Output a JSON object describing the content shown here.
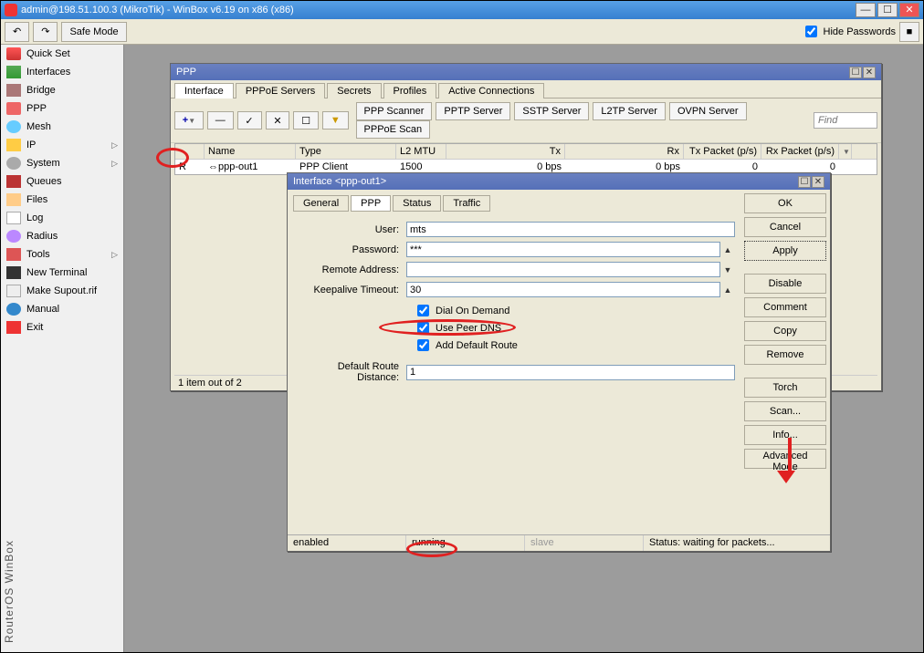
{
  "title": "admin@198.51.100.3 (MikroTik) - WinBox v6.19 on x86 (x86)",
  "toolbar": {
    "safemode": "Safe Mode",
    "hidepw": "Hide Passwords"
  },
  "sidebar": [
    {
      "label": "Quick Set",
      "cls": "qs"
    },
    {
      "label": "Interfaces",
      "cls": "if"
    },
    {
      "label": "Bridge",
      "cls": "br"
    },
    {
      "label": "PPP",
      "cls": "ppp"
    },
    {
      "label": "Mesh",
      "cls": "mesh"
    },
    {
      "label": "IP",
      "cls": "ip",
      "sub": true
    },
    {
      "label": "System",
      "cls": "sys",
      "sub": true
    },
    {
      "label": "Queues",
      "cls": "qu"
    },
    {
      "label": "Files",
      "cls": "fi"
    },
    {
      "label": "Log",
      "cls": "lg"
    },
    {
      "label": "Radius",
      "cls": "rd"
    },
    {
      "label": "Tools",
      "cls": "to",
      "sub": true
    },
    {
      "label": "New Terminal",
      "cls": "nt"
    },
    {
      "label": "Make Supout.rif",
      "cls": "ms"
    },
    {
      "label": "Manual",
      "cls": "mn"
    },
    {
      "label": "Exit",
      "cls": "ex"
    }
  ],
  "rotlabel": "RouterOS WinBox",
  "ppp": {
    "title": "PPP",
    "tabs": [
      "Interface",
      "PPPoE Servers",
      "Secrets",
      "Profiles",
      "Active Connections"
    ],
    "btns": [
      "PPP Scanner",
      "PPTP Server",
      "SSTP Server",
      "L2TP Server",
      "OVPN Server",
      "PPPoE Scan"
    ],
    "find": "Find",
    "cols": [
      "",
      "Name",
      "Type",
      "L2 MTU",
      "Tx",
      "Rx",
      "Tx Packet (p/s)",
      "Rx Packet (p/s)"
    ],
    "row": {
      "flag": "R",
      "name": "ppp-out1",
      "type": "PPP Client",
      "l2mtu": "1500",
      "tx": "0 bps",
      "rx": "0 bps",
      "txp": "0",
      "rxp": "0"
    },
    "status": "1 item out of 2"
  },
  "iface": {
    "title": "Interface <ppp-out1>",
    "tabs": [
      "General",
      "PPP",
      "Status",
      "Traffic"
    ],
    "labels": {
      "user": "User:",
      "password": "Password:",
      "remote": "Remote Address:",
      "keepalive": "Keepalive Timeout:",
      "drd": "Default Route Distance:"
    },
    "vals": {
      "user": "mts",
      "password": "***",
      "remote": "",
      "keepalive": "30",
      "drd": "1"
    },
    "checks": {
      "dod": "Dial On Demand",
      "upd": "Use Peer DNS",
      "adr": "Add Default Route"
    },
    "btns": [
      "OK",
      "Cancel",
      "Apply",
      "Disable",
      "Comment",
      "Copy",
      "Remove",
      "Torch",
      "Scan...",
      "Info...",
      "Advanced Mode"
    ],
    "status": {
      "enabled": "enabled",
      "running": "running",
      "slave": "slave",
      "summary": "Status: waiting for packets..."
    }
  }
}
